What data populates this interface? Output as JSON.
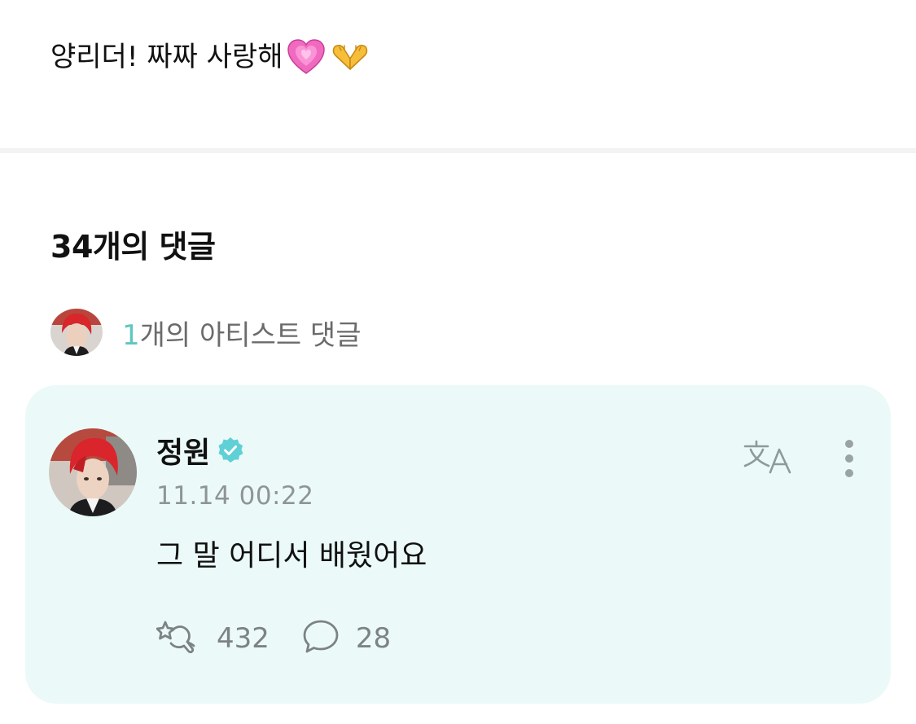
{
  "post": {
    "text": "양리더! 짜짜 사랑해"
  },
  "comments_section": {
    "title": "34개의 댓글",
    "artist_summary": {
      "count": "1",
      "label": "개의 아티스트 댓글"
    }
  },
  "comment": {
    "author": "정원",
    "timestamp": "11.14 00:22",
    "body": "그 말 어디서 배웠어요",
    "likes": "432",
    "replies": "28"
  },
  "icons": {
    "post_emojis": [
      "growing-heart-icon",
      "heart-hands-icon"
    ],
    "verified": "verified-badge-icon",
    "translate": "translate-icon",
    "more": "more-vertical-icon",
    "like": "like-icon",
    "reply": "reply-bubble-icon"
  },
  "colors": {
    "accent": "#5fc6c3",
    "card_background": "#ebfaf8",
    "verified": "#5fd0d6",
    "muted_text": "#8f9495"
  }
}
